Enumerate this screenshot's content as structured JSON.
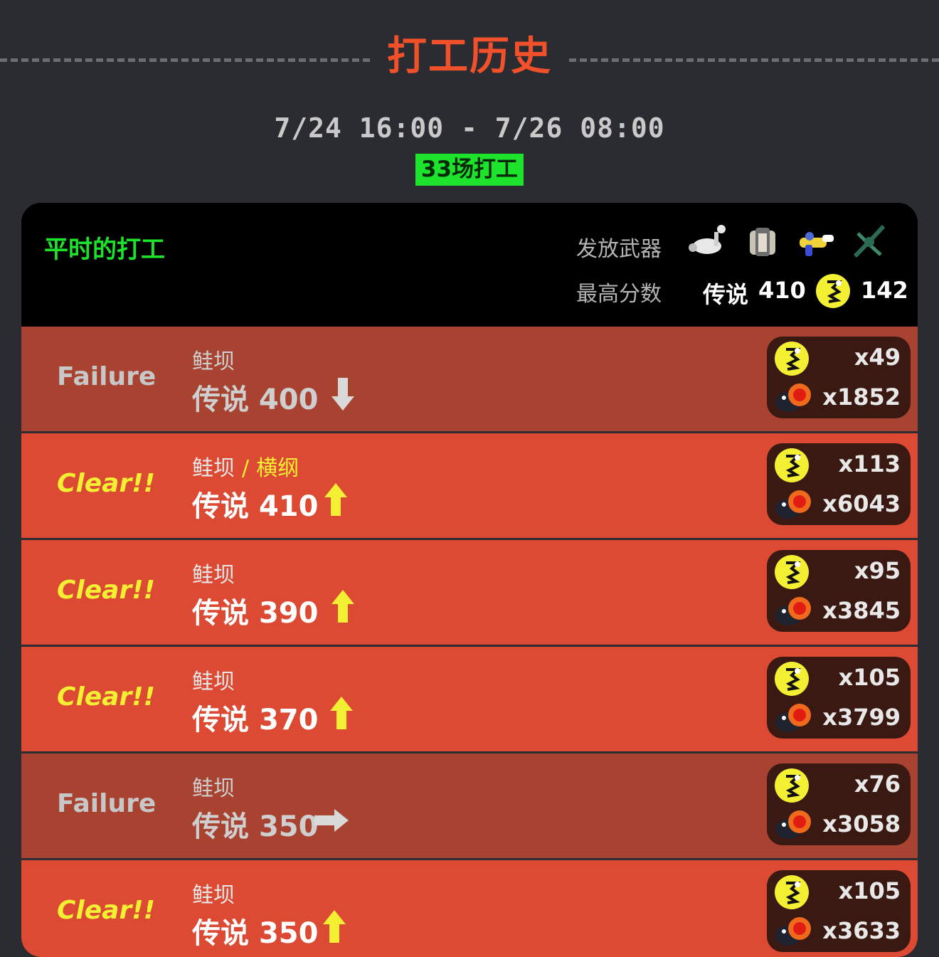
{
  "header": {
    "title": "打工历史"
  },
  "period": {
    "range": "7/24 16:00 - 7/26 08:00",
    "count": "33场打工"
  },
  "panel": {
    "mode_title": "平时的打工",
    "weapons_label": "发放武器",
    "best_label": "最高分数",
    "weapons": [
      "splatterscope-icon",
      "tri-stringer-icon",
      "sploosh-o-matic-icon",
      "tri-bow-icon"
    ],
    "best_grade": "传说",
    "best_score": "410",
    "best_golden_eggs": "142"
  },
  "rows": [
    {
      "result": "Failure",
      "stage": "鲑坝",
      "king": "",
      "sep": "",
      "grade": "传说",
      "score": "400",
      "trend": "down",
      "golden": "x49",
      "power": "x1852"
    },
    {
      "result": "Clear!!",
      "stage": "鲑坝",
      "king": "横纲",
      "sep": "/",
      "grade": "传说",
      "score": "410",
      "trend": "up",
      "golden": "x113",
      "power": "x6043"
    },
    {
      "result": "Clear!!",
      "stage": "鲑坝",
      "king": "",
      "sep": "",
      "grade": "传说",
      "score": "390",
      "trend": "up",
      "golden": "x95",
      "power": "x3845"
    },
    {
      "result": "Clear!!",
      "stage": "鲑坝",
      "king": "",
      "sep": "",
      "grade": "传说",
      "score": "370",
      "trend": "up",
      "golden": "x105",
      "power": "x3799"
    },
    {
      "result": "Failure",
      "stage": "鲑坝",
      "king": "",
      "sep": "",
      "grade": "传说",
      "score": "350",
      "trend": "flat",
      "golden": "x76",
      "power": "x3058"
    },
    {
      "result": "Clear!!",
      "stage": "鲑坝",
      "king": "",
      "sep": "",
      "grade": "传说",
      "score": "350",
      "trend": "up",
      "golden": "x105",
      "power": "x3633"
    }
  ],
  "colors": {
    "accent_red": "#f2502a",
    "green": "#1ee32c",
    "yellow": "#f3ef33",
    "fail_row": "#a84332",
    "clear_row": "#dc4a33"
  }
}
